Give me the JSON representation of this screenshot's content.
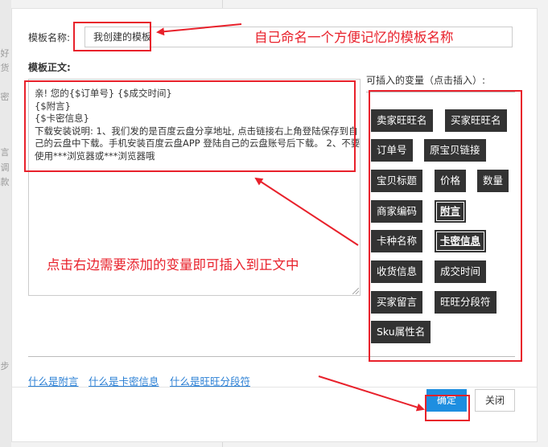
{
  "background_fragments": [
    "好",
    "货",
    "密",
    "言",
    "调",
    "款",
    "步"
  ],
  "dialog": {
    "name_label": "模板名称:",
    "name_value": "我创建的模板",
    "body_label": "模板正文:",
    "body_text": "亲! 您的{$订单号} {$成交时间}\n{$附言}\n{$卡密信息}\n下载安装说明: 1、我们发的是百度云盘分享地址, 点击链接右上角登陆保存到自己的云盘中下载。手机安装百度云盘APP 登陆自己的云盘账号后下载。 2、不要使用***浏览器或***浏览器哦",
    "variables_label": "可插入的变量（点击插入）:",
    "variables": [
      {
        "label": "卖家旺旺名",
        "highlight": false
      },
      {
        "label": "买家旺旺名",
        "highlight": false
      },
      {
        "label": "订单号",
        "highlight": false
      },
      {
        "label": "原宝贝链接",
        "highlight": false
      },
      {
        "label": "宝贝标题",
        "highlight": false
      },
      {
        "label": "价格",
        "highlight": false
      },
      {
        "label": "数量",
        "highlight": false
      },
      {
        "label": "商家编码",
        "highlight": false
      },
      {
        "label": "附言",
        "highlight": true
      },
      {
        "label": "卡种名称",
        "highlight": false
      },
      {
        "label": "卡密信息",
        "highlight": true
      },
      {
        "label": "收货信息",
        "highlight": false
      },
      {
        "label": "成交时间",
        "highlight": false
      },
      {
        "label": "买家留言",
        "highlight": false
      },
      {
        "label": "旺旺分段符",
        "highlight": false
      },
      {
        "label": "Sku属性名",
        "highlight": false
      }
    ],
    "help_links": [
      "什么是附言",
      "什么是卡密信息",
      "什么是旺旺分段符"
    ],
    "confirm_label": "确定",
    "close_label": "关闭"
  },
  "annotations": {
    "name_hint": "自己命名一个方便记忆的模板名称",
    "variable_hint": "点击右边需要添加的变量即可插入到正文中"
  },
  "colors": {
    "annotation_red": "#e8212b",
    "variable_button_bg": "#333333",
    "primary_button": "#1e8ee0",
    "link": "#2a7fd4"
  }
}
